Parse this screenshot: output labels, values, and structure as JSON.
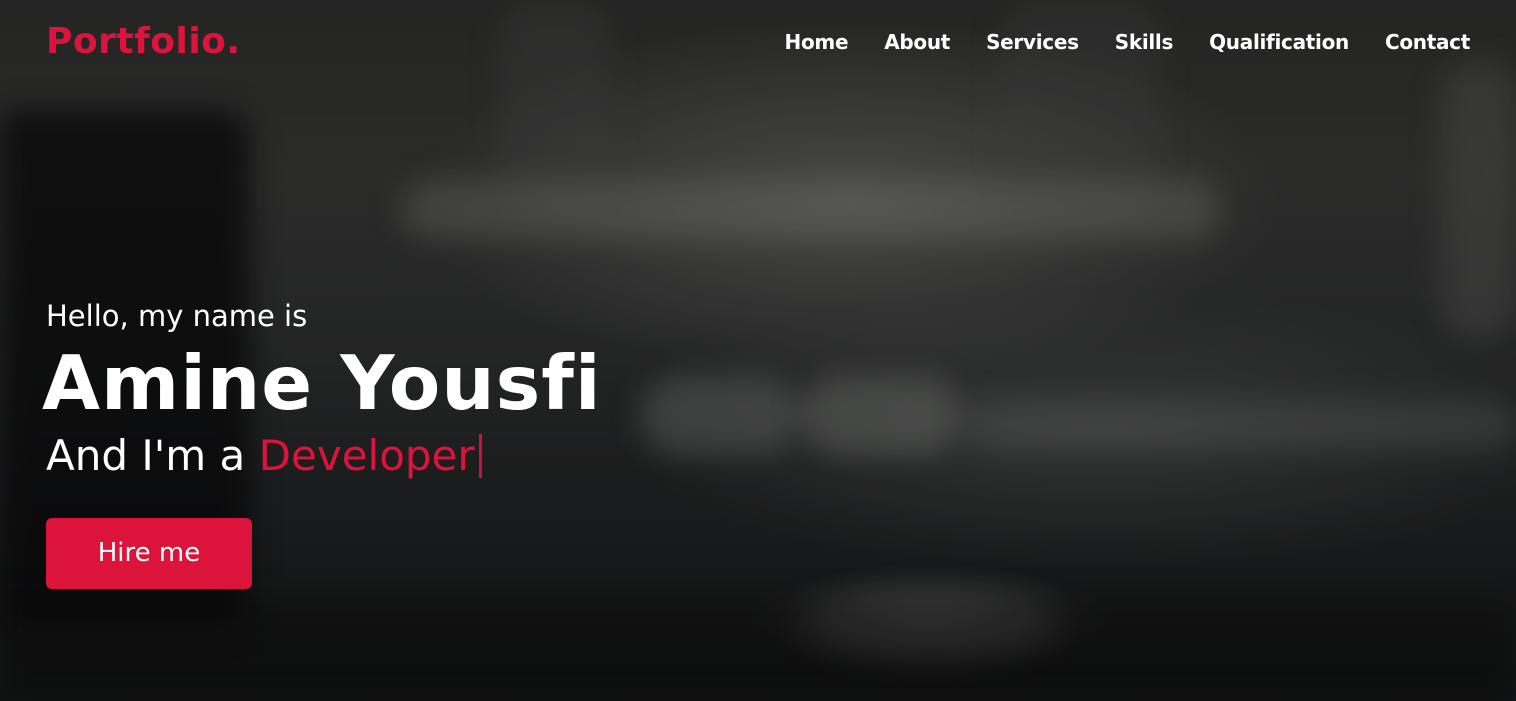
{
  "brand": {
    "logo_text": "Portfolio.",
    "accent_color": "#dc143c"
  },
  "nav": {
    "items": [
      {
        "label": "Home"
      },
      {
        "label": "About"
      },
      {
        "label": "Services"
      },
      {
        "label": "Skills"
      },
      {
        "label": "Qualification"
      },
      {
        "label": "Contact"
      }
    ]
  },
  "hero": {
    "greeting": "Hello, my name is",
    "name": "Amine Yousfi",
    "intro_prefix": "And I'm a",
    "role": "Developer",
    "cta_label": "Hire me"
  }
}
